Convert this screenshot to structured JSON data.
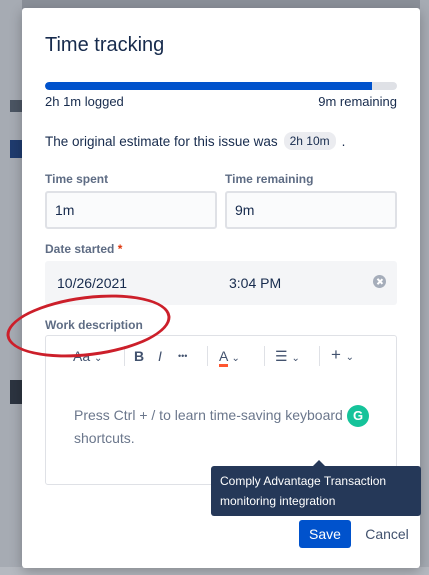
{
  "modal": {
    "title": "Time tracking",
    "progress_fraction": 0.93,
    "logged_label": "2h 1m logged",
    "remaining_label": "9m remaining",
    "estimate_text": "The original estimate for this issue was",
    "estimate_value": "2h 10m",
    "estimate_suffix": "."
  },
  "fields": {
    "time_spent": {
      "label": "Time spent",
      "value": "1m"
    },
    "time_remaining": {
      "label": "Time remaining",
      "value": "9m"
    },
    "date_started": {
      "label": "Date started",
      "required_mark": "*",
      "date": "10/26/2021",
      "time": "3:04 PM"
    },
    "work_description": {
      "label": "Work description",
      "placeholder": "Press Ctrl + / to learn time-saving keyboard shortcuts."
    }
  },
  "toolbar": {
    "text_style_label": "Aa",
    "bold": "B",
    "italic": "I",
    "more": "•••",
    "text_color": "A",
    "list_glyph": "☰",
    "insert": "+",
    "caret": "⌄"
  },
  "grammarly": "G",
  "tooltip": {
    "text": "Comply Advantage Transaction monitoring integration"
  },
  "buttons": {
    "save": "Save",
    "cancel": "Cancel"
  },
  "colors": {
    "primary": "#0052cc",
    "annotation": "#cc1f2a",
    "grammarly": "#15c39a"
  }
}
